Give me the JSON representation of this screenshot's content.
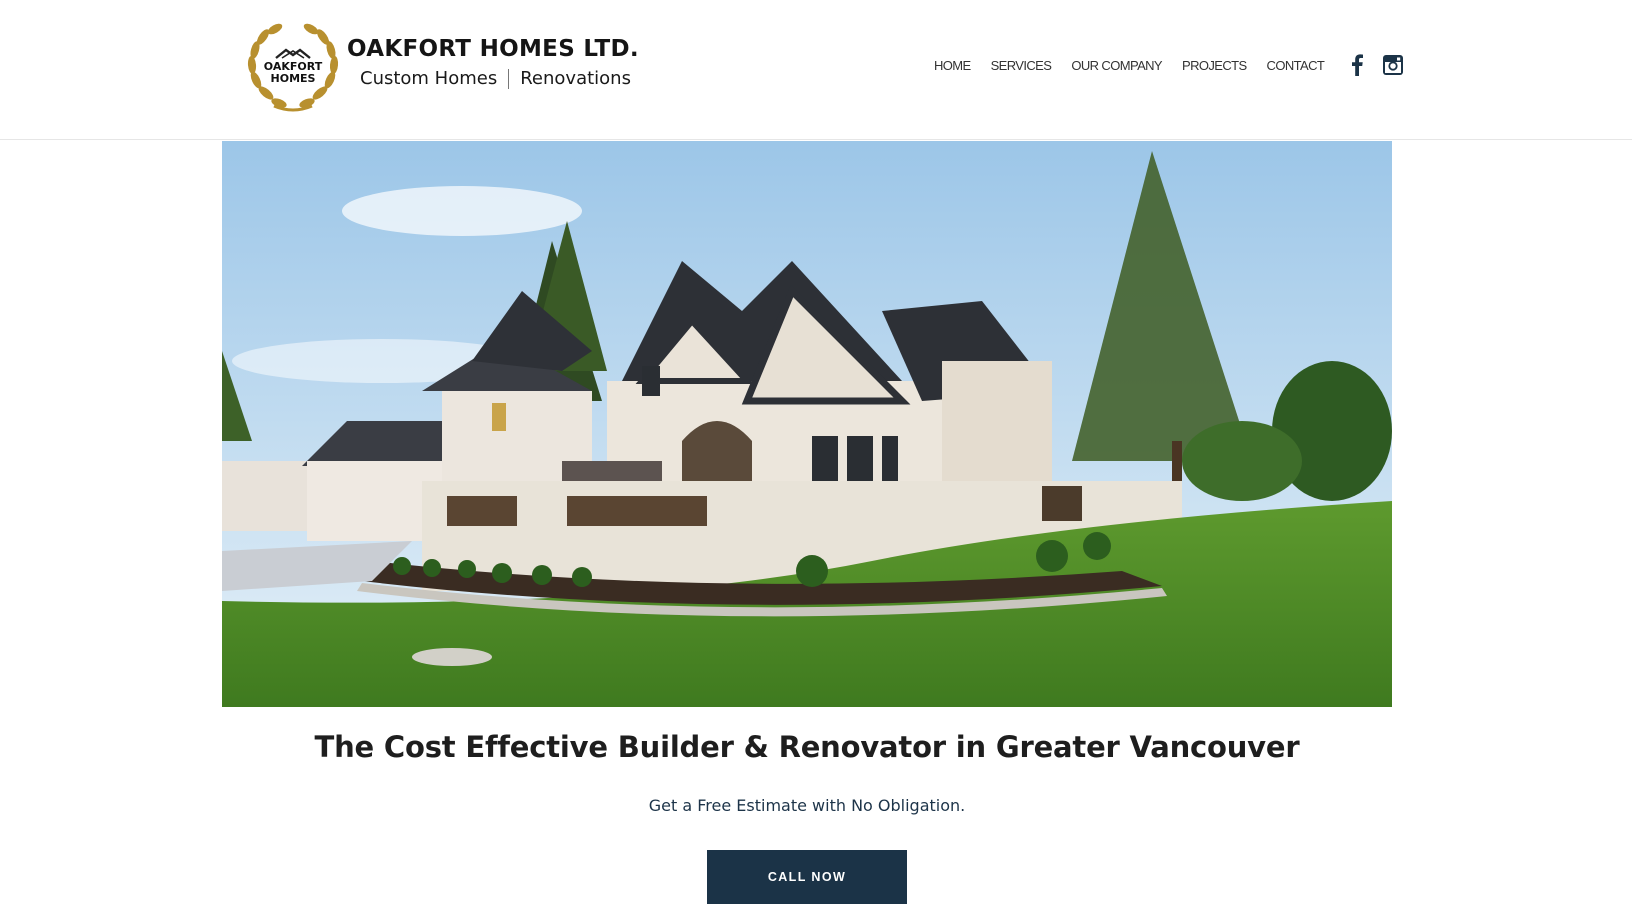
{
  "header": {
    "logo": {
      "emblem_text_line1": "OAKFORT",
      "emblem_text_line2": "HOMES",
      "company_name": "OAKFORT HOMES LTD.",
      "tagline_left": "Custom Homes",
      "tagline_right": "Renovations"
    },
    "nav": [
      {
        "label": "HOME"
      },
      {
        "label": "SERVICES"
      },
      {
        "label": "OUR COMPANY"
      },
      {
        "label": "PROJECTS"
      },
      {
        "label": "CONTACT"
      }
    ],
    "social": [
      {
        "icon": "facebook-icon"
      },
      {
        "icon": "instagram-icon"
      }
    ]
  },
  "hero": {
    "image_subject": "house-photo"
  },
  "content": {
    "headline": "The Cost Effective Builder & Renovator in Greater Vancouver",
    "subtext": "Get a Free Estimate with No Obligation.",
    "cta_label": "CALL NOW"
  },
  "colors": {
    "accent": "#1b3347",
    "nav_text": "#333333",
    "logo_gold": "#b8902f"
  }
}
